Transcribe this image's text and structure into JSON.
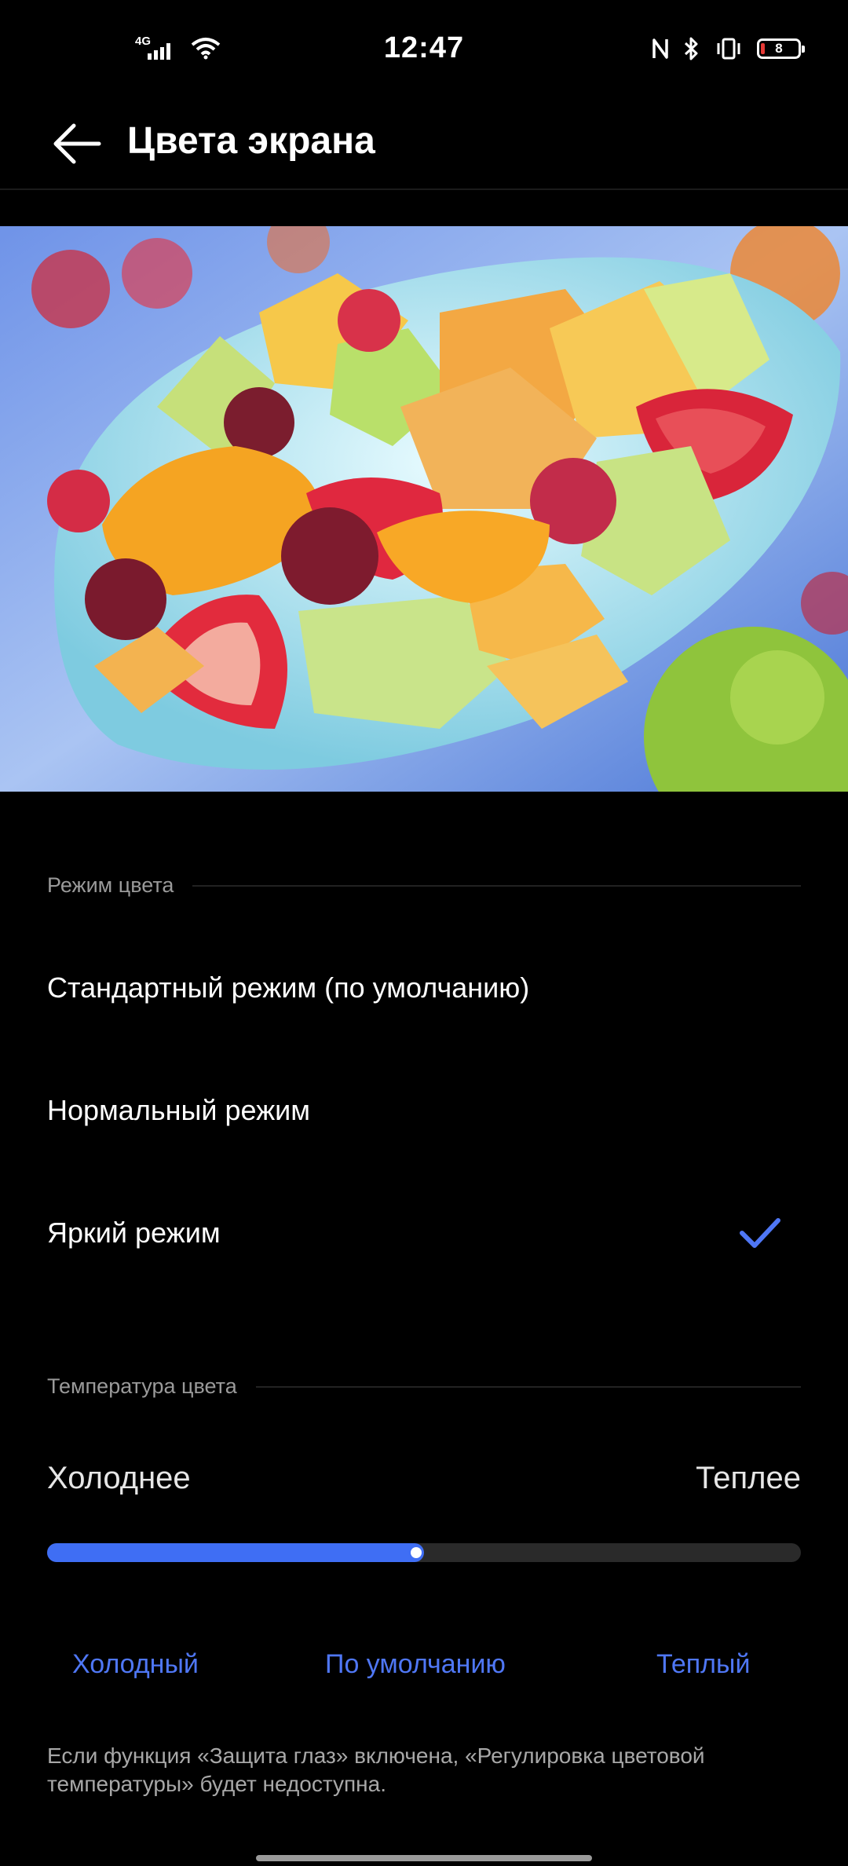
{
  "status": {
    "network": "4G",
    "time": "12:47",
    "battery": "8"
  },
  "header": {
    "title": "Цвета экрана"
  },
  "color_mode": {
    "section_label": "Режим цвета",
    "options": [
      {
        "label": "Стандартный режим (по умолчанию)",
        "selected": false
      },
      {
        "label": "Нормальный режим",
        "selected": false
      },
      {
        "label": "Яркий режим",
        "selected": true
      }
    ]
  },
  "temperature": {
    "section_label": "Температура цвета",
    "cold_label": "Холоднее",
    "warm_label": "Теплее",
    "slider_value": 0.49,
    "presets": [
      "Холодный",
      "По умолчанию",
      "Теплый"
    ],
    "note": "Если функция «Защита глаз» включена, «Регулировка цветовой температуры» будет недоступна."
  },
  "colors": {
    "accent": "#4f77f5",
    "background": "#000000"
  }
}
